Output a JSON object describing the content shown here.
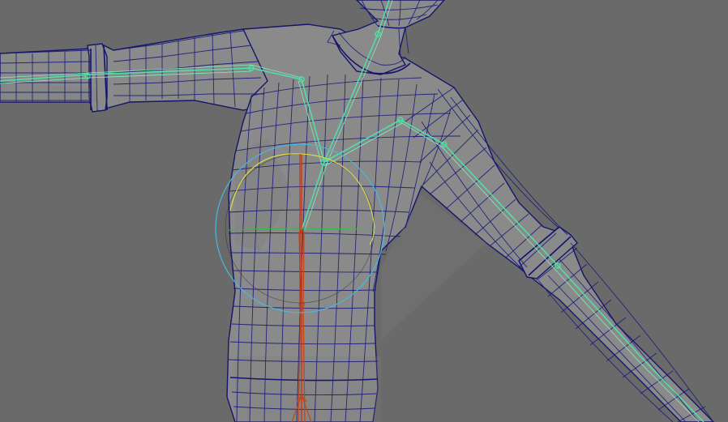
{
  "viewport": {
    "background_color": "#6a6a6a",
    "mesh_color": "#8a8a8a",
    "wireframe_color": "#15156a",
    "bone_color": "#4fe0a8",
    "root_bone_color": "#c0481a",
    "rotate_gizmo_colors": {
      "outer_ring": "#4ab8d8",
      "x_axis": "#d03010",
      "y_axis": "#e6e040",
      "z_axis": "#30c040"
    }
  }
}
